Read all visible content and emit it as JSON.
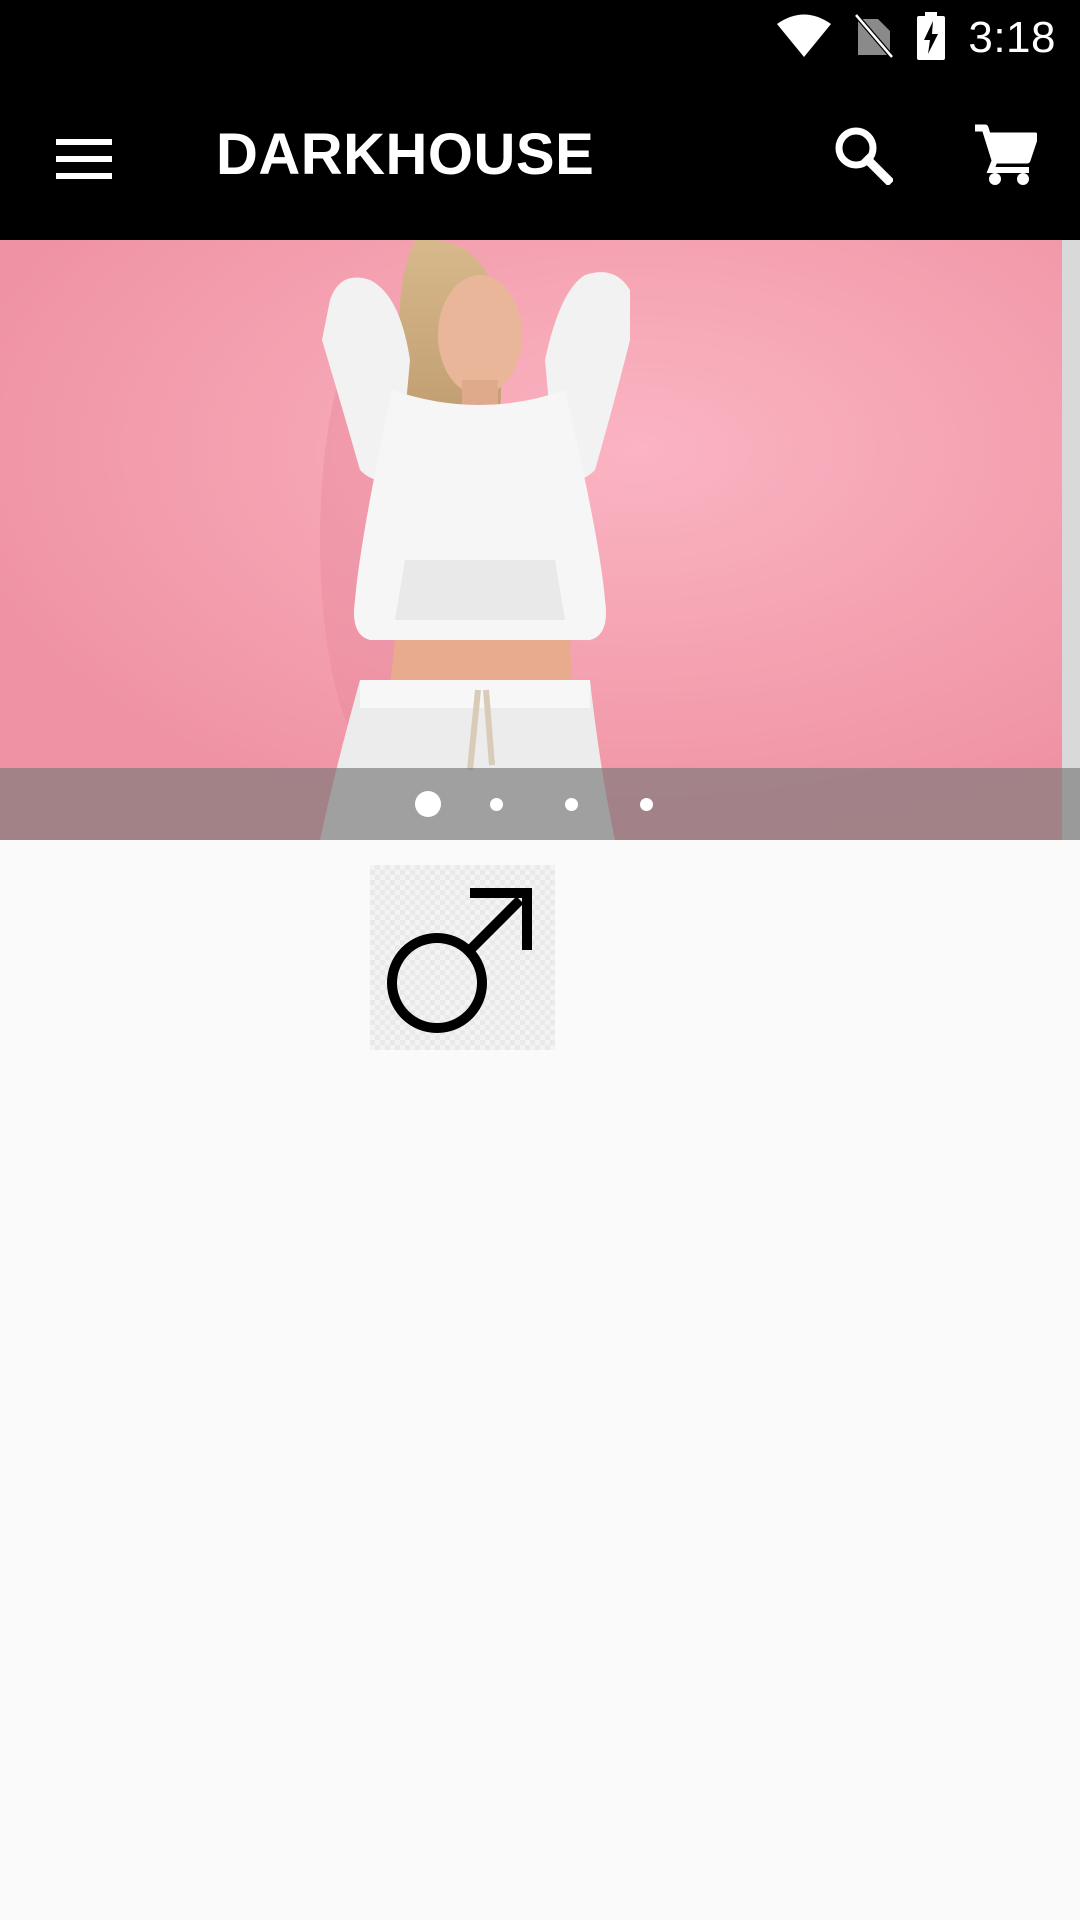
{
  "status_bar": {
    "time": "3:18",
    "icons": [
      "wifi-icon",
      "no-sim-icon",
      "battery-charging-icon"
    ]
  },
  "app_bar": {
    "title": "DARKHOUSE",
    "icons": [
      "menu-icon",
      "search-icon",
      "cart-icon"
    ]
  },
  "carousel": {
    "slide_count": 4,
    "active_index": 0,
    "image": "woman-in-white-sweatsuit-pink-background"
  },
  "category": {
    "icon": "male-symbol-icon"
  },
  "colors": {
    "app_bar": "#000000",
    "slide_background": "#f6a9b8",
    "page_background": "#fafafa"
  }
}
